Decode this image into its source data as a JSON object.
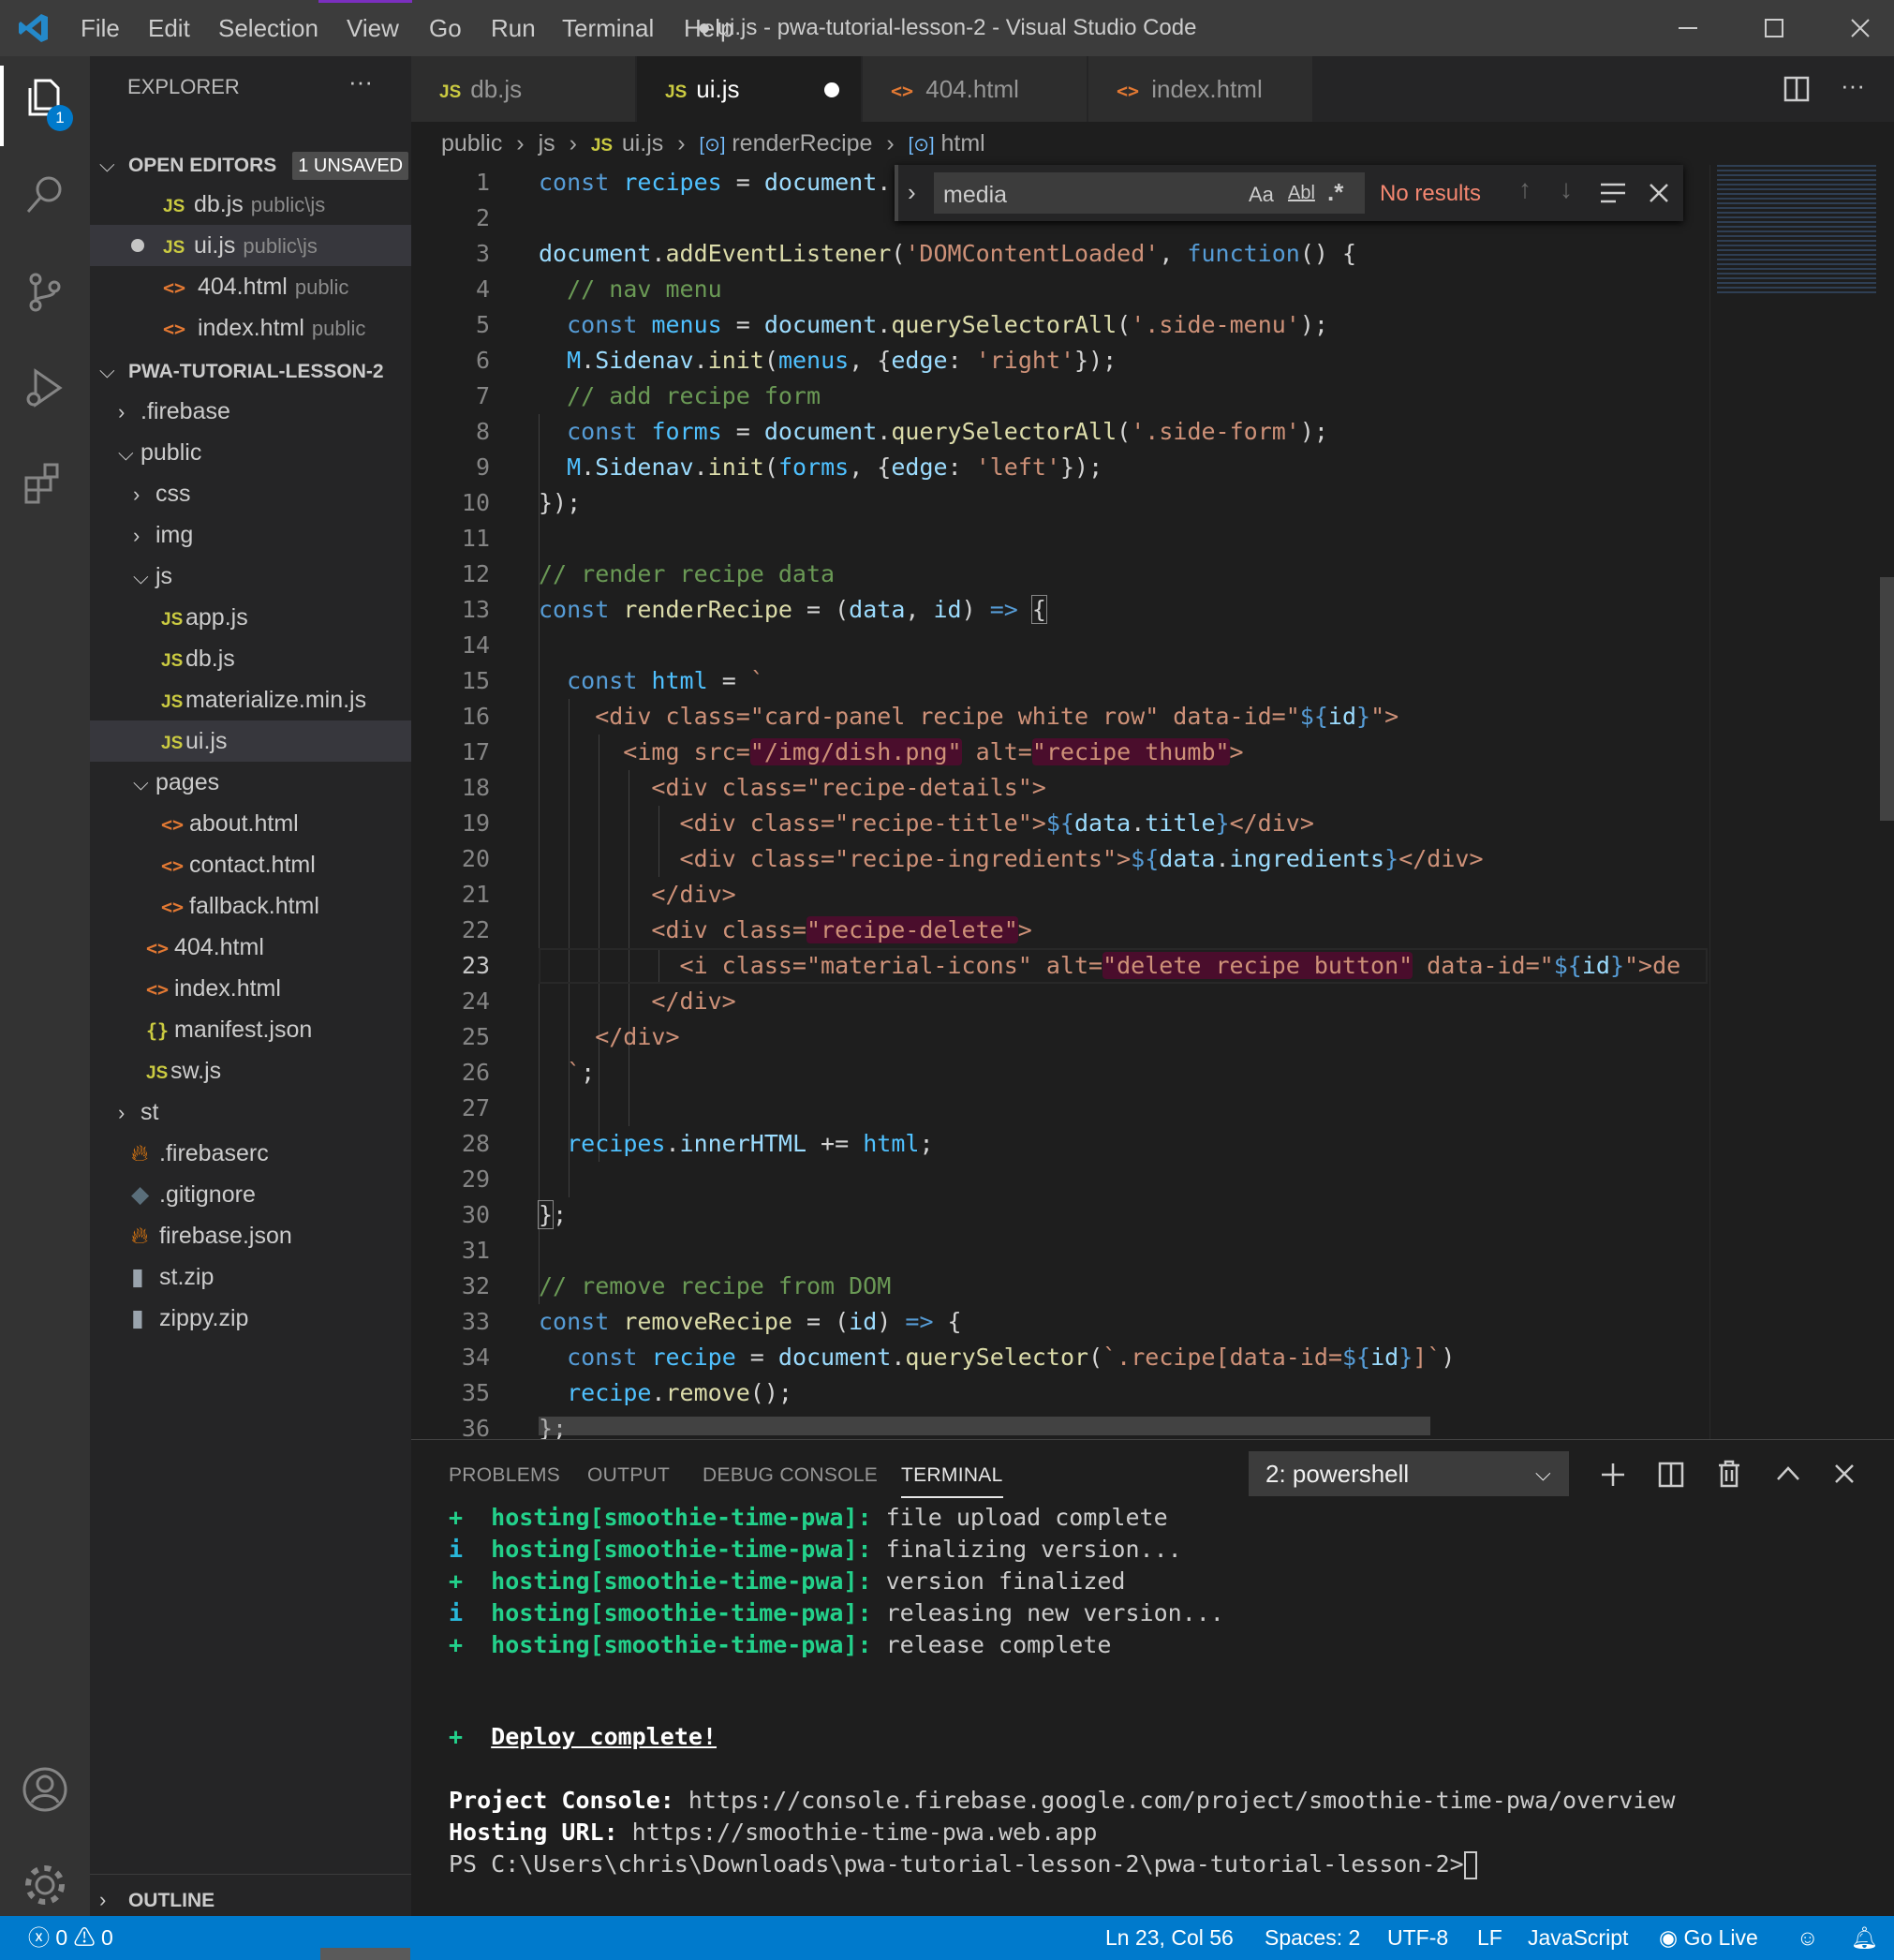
{
  "window": {
    "title": "● ui.js - pwa-tutorial-lesson-2 - Visual Studio Code",
    "menu": [
      "File",
      "Edit",
      "Selection",
      "View",
      "Go",
      "Run",
      "Terminal",
      "Help"
    ]
  },
  "activity": {
    "badge": "1"
  },
  "sidebar": {
    "header": "EXPLORER",
    "open_editors": {
      "label": "OPEN EDITORS",
      "badge": "1 UNSAVED",
      "items": [
        {
          "name": "db.js",
          "desc": "public\\js",
          "type": "js"
        },
        {
          "name": "ui.js",
          "desc": "public\\js",
          "type": "js"
        },
        {
          "name": "404.html",
          "desc": "public",
          "type": "html"
        },
        {
          "name": "index.html",
          "desc": "public",
          "type": "html"
        }
      ]
    },
    "project": {
      "label": "PWA-TUTORIAL-LESSON-2",
      "tree": [
        {
          "name": ".firebase",
          "kind": "folder-closed"
        },
        {
          "name": "public",
          "kind": "folder-open"
        },
        {
          "name": "css",
          "kind": "folder-closed"
        },
        {
          "name": "img",
          "kind": "folder-closed"
        },
        {
          "name": "js",
          "kind": "folder-open"
        },
        {
          "name": "app.js",
          "kind": "js"
        },
        {
          "name": "db.js",
          "kind": "js"
        },
        {
          "name": "materialize.min.js",
          "kind": "js"
        },
        {
          "name": "ui.js",
          "kind": "js"
        },
        {
          "name": "pages",
          "kind": "folder-open"
        },
        {
          "name": "about.html",
          "kind": "html"
        },
        {
          "name": "contact.html",
          "kind": "html"
        },
        {
          "name": "fallback.html",
          "kind": "html"
        },
        {
          "name": "404.html",
          "kind": "html"
        },
        {
          "name": "index.html",
          "kind": "html"
        },
        {
          "name": "manifest.json",
          "kind": "json"
        },
        {
          "name": "sw.js",
          "kind": "js"
        },
        {
          "name": "st",
          "kind": "folder-closed"
        },
        {
          "name": ".firebaserc",
          "kind": "firebase"
        },
        {
          "name": ".gitignore",
          "kind": "git"
        },
        {
          "name": "firebase.json",
          "kind": "firebase"
        },
        {
          "name": "st.zip",
          "kind": "zip"
        },
        {
          "name": "zippy.zip",
          "kind": "zip"
        }
      ]
    },
    "outline": "OUTLINE"
  },
  "tabs": [
    {
      "label": "db.js",
      "type": "JS"
    },
    {
      "label": "ui.js",
      "type": "JS"
    },
    {
      "label": "404.html",
      "type": "html"
    },
    {
      "label": "index.html",
      "type": "html"
    }
  ],
  "breadcrumb": [
    "public",
    "js",
    "ui.js",
    "renderRecipe",
    "html"
  ],
  "find": {
    "query": "media",
    "result": "No results",
    "opt_case": "Aa",
    "opt_word": "Abl",
    "opt_regex": ".*"
  },
  "code_lines": [
    "1",
    "2",
    "3",
    "4",
    "5",
    "6",
    "7",
    "8",
    "9",
    "10",
    "11",
    "12",
    "13",
    "14",
    "15",
    "16",
    "17",
    "18",
    "19",
    "20",
    "21",
    "22",
    "23",
    "24",
    "25",
    "26",
    "27",
    "28",
    "29",
    "30",
    "31",
    "32",
    "33",
    "34",
    "35",
    "36"
  ],
  "panel": {
    "tabs": [
      "PROBLEMS",
      "OUTPUT",
      "DEBUG CONSOLE",
      "TERMINAL"
    ],
    "terminal_select": "2: powershell",
    "lines": [
      {
        "mark": "+",
        "host": "hosting[smoothie-time-pwa]:",
        "msg": " file upload complete"
      },
      {
        "mark": "i",
        "host": "hosting[smoothie-time-pwa]:",
        "msg": " finalizing version..."
      },
      {
        "mark": "+",
        "host": "hosting[smoothie-time-pwa]:",
        "msg": " version finalized"
      },
      {
        "mark": "i",
        "host": "hosting[smoothie-time-pwa]:",
        "msg": " releasing new version..."
      },
      {
        "mark": "+",
        "host": "hosting[smoothie-time-pwa]:",
        "msg": " release complete"
      }
    ],
    "deploy_mark": "+",
    "deploy": "Deploy complete!",
    "console_label": "Project Console:",
    "console_url": " https://console.firebase.google.com/project/smoothie-time-pwa/overview",
    "hosting_label": "Hosting URL:",
    "hosting_url": " https://smoothie-time-pwa.web.app",
    "prompt": "PS C:\\Users\\chris\\Downloads\\pwa-tutorial-lesson-2\\pwa-tutorial-lesson-2>"
  },
  "status": {
    "errors": "0",
    "warnings": "0",
    "position": "Ln 23, Col 56",
    "spaces": "Spaces: 2",
    "encoding": "UTF-8",
    "eol": "LF",
    "language": "JavaScript",
    "golive": "Go Live"
  }
}
